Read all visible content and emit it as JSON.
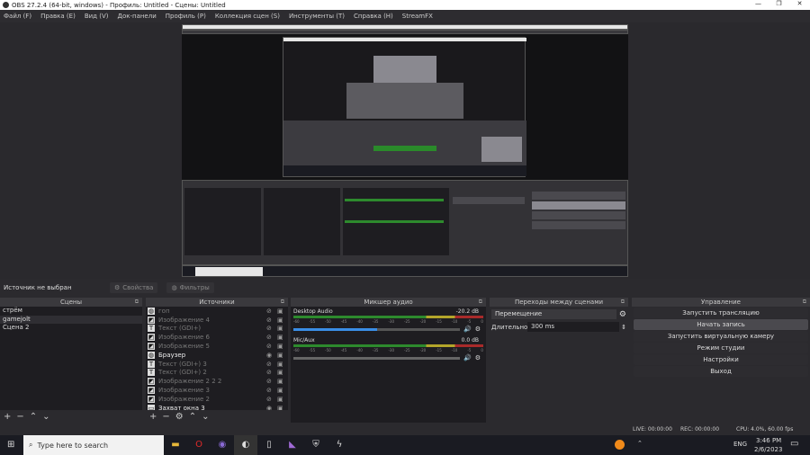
{
  "window": {
    "title": "OBS 27.2.4 (64-bit, windows) - Профиль: Untitled - Сцены: Untitled",
    "minimize": "—",
    "maximize": "❐",
    "close": "✕"
  },
  "menu": [
    "Файл (F)",
    "Правка (E)",
    "Вид (V)",
    "Док-панели",
    "Профиль (P)",
    "Коллекция сцен (S)",
    "Инструменты (T)",
    "Справка (H)",
    "StreamFX"
  ],
  "source_toolbar": {
    "status": "Источник не выбран",
    "properties": "Свойства",
    "filters": "Фильтры"
  },
  "scenes": {
    "title": "Сцены",
    "items": [
      "стрём",
      "gamejolt",
      "Сцена 2"
    ],
    "selected": 1
  },
  "sources": {
    "title": "Источники",
    "items": [
      {
        "name": "гоп",
        "icon": "globe",
        "visible": false
      },
      {
        "name": "Изображение 4",
        "icon": "image",
        "visible": false
      },
      {
        "name": "Текст (GDI+)",
        "icon": "text",
        "visible": false
      },
      {
        "name": "Изображение 6",
        "icon": "image",
        "visible": false
      },
      {
        "name": "Изображение 5",
        "icon": "image",
        "visible": false
      },
      {
        "name": "Браузер",
        "icon": "globe",
        "visible": true
      },
      {
        "name": "Текст (GDI+) 3",
        "icon": "text",
        "visible": false
      },
      {
        "name": "Текст (GDI+) 2",
        "icon": "text",
        "visible": false
      },
      {
        "name": "Изображение 2 2 2",
        "icon": "image",
        "visible": false
      },
      {
        "name": "Изображение 3",
        "icon": "image",
        "visible": false
      },
      {
        "name": "Изображение 2",
        "icon": "image",
        "visible": false
      },
      {
        "name": "Захват окна 3",
        "icon": "window",
        "visible": true
      }
    ]
  },
  "mixer": {
    "title": "Микшер аудио",
    "channels": [
      {
        "name": "Desktop Audio",
        "db": "-20.2 dB",
        "volume": 0.5,
        "muted": false
      },
      {
        "name": "Mic/Aux",
        "db": "0.0 dB",
        "volume": 1.0,
        "muted": false
      }
    ],
    "ticks": [
      "-60",
      "-55",
      "-50",
      "-45",
      "-40",
      "-35",
      "-30",
      "-25",
      "-20",
      "-15",
      "-10",
      "-5",
      "0"
    ]
  },
  "transitions": {
    "title": "Переходы между сценами",
    "selected": "Перемещение",
    "duration_label": "Длительность",
    "duration": "300 ms"
  },
  "controls": {
    "title": "Управление",
    "buttons": [
      "Запустить трансляцию",
      "Начать запись",
      "Запустить виртуальную камеру",
      "Режим студии",
      "Настройки",
      "Выход"
    ],
    "highlighted": 1
  },
  "status": {
    "live": "LIVE: 00:00:00",
    "rec": "REC: 00:00:00",
    "cpu": "CPU: 4.0%, 60.00 fps"
  },
  "taskbar": {
    "search_placeholder": "Type here to search",
    "lang": "ENG",
    "time": "3:46 PM",
    "date": "2/6/2023"
  }
}
